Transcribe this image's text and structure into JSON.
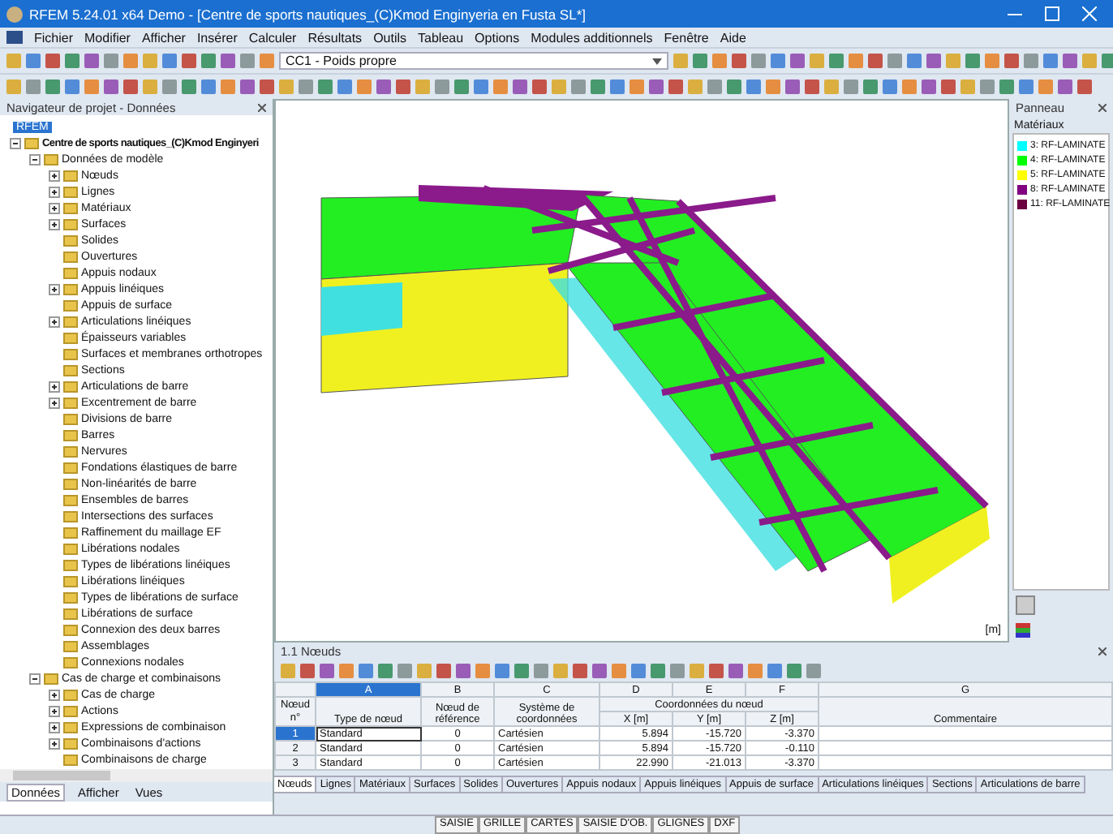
{
  "window": {
    "title": "RFEM 5.24.01 x64 Demo - [Centre de sports nautiques_(C)Kmod Enginyeria en Fusta SL*]"
  },
  "menu": [
    "Fichier",
    "Modifier",
    "Afficher",
    "Insérer",
    "Calculer",
    "Résultats",
    "Outils",
    "Tableau",
    "Options",
    "Modules additionnels",
    "Fenêtre",
    "Aide"
  ],
  "load_case_select": {
    "value": "CC1 - Poids propre"
  },
  "navigator": {
    "title": "Navigateur de projet - Données",
    "root": "RFEM",
    "tree": [
      {
        "label": "Centre de sports nautiques_(C)Kmod Enginyeri",
        "expanded": true,
        "bold": true,
        "children": [
          {
            "label": "Données de modèle",
            "expanded": true,
            "children": [
              {
                "label": "Nœuds",
                "expanded": false
              },
              {
                "label": "Lignes",
                "expanded": false
              },
              {
                "label": "Matériaux",
                "expanded": false
              },
              {
                "label": "Surfaces",
                "expanded": false
              },
              {
                "label": "Solides"
              },
              {
                "label": "Ouvertures"
              },
              {
                "label": "Appuis nodaux"
              },
              {
                "label": "Appuis linéiques",
                "expanded": false
              },
              {
                "label": "Appuis de surface"
              },
              {
                "label": "Articulations linéiques",
                "expanded": false
              },
              {
                "label": "Épaisseurs variables"
              },
              {
                "label": "Surfaces et membranes orthotropes"
              },
              {
                "label": "Sections"
              },
              {
                "label": "Articulations de barre",
                "expanded": false
              },
              {
                "label": "Excentrement de barre",
                "expanded": false
              },
              {
                "label": "Divisions de barre"
              },
              {
                "label": "Barres"
              },
              {
                "label": "Nervures"
              },
              {
                "label": "Fondations élastiques de barre"
              },
              {
                "label": "Non-linéarités de barre"
              },
              {
                "label": "Ensembles de barres"
              },
              {
                "label": "Intersections des surfaces"
              },
              {
                "label": "Raffinement du maillage EF"
              },
              {
                "label": "Libérations nodales"
              },
              {
                "label": "Types de libérations linéiques"
              },
              {
                "label": "Libérations linéiques"
              },
              {
                "label": "Types de libérations de surface"
              },
              {
                "label": "Libérations de surface"
              },
              {
                "label": "Connexion des deux barres"
              },
              {
                "label": "Assemblages"
              },
              {
                "label": "Connexions nodales"
              }
            ]
          },
          {
            "label": "Cas de charge et combinaisons",
            "expanded": true,
            "children": [
              {
                "label": "Cas de charge",
                "expanded": false
              },
              {
                "label": "Actions",
                "expanded": false
              },
              {
                "label": "Expressions de combinaison",
                "expanded": false
              },
              {
                "label": "Combinaisons d'actions",
                "expanded": false
              },
              {
                "label": "Combinaisons de charge"
              }
            ]
          }
        ]
      }
    ],
    "tabs": [
      {
        "label": "Données",
        "selected": true
      },
      {
        "label": "Afficher",
        "selected": false
      },
      {
        "label": "Vues",
        "selected": false
      }
    ]
  },
  "viewport": {
    "unit": "[m]"
  },
  "panel": {
    "title": "Panneau",
    "section": "Matériaux",
    "legend": [
      {
        "label": "3: RF-LAMINATE",
        "color": "#00ffff"
      },
      {
        "label": "4: RF-LAMINATE",
        "color": "#00ff00"
      },
      {
        "label": "5: RF-LAMINATE",
        "color": "#ffff00"
      },
      {
        "label": "8: RF-LAMINATE",
        "color": "#800080"
      },
      {
        "label": "11: RF-LAMINATE",
        "color": "#6a0040"
      }
    ]
  },
  "table": {
    "title": "1.1 Nœuds",
    "row_header": "Nœud n°",
    "group_header": "Coordonnées du nœud",
    "columns": [
      {
        "letter": "A",
        "selected": true,
        "header": "Type de nœud"
      },
      {
        "letter": "B",
        "selected": false,
        "header": "Nœud de référence"
      },
      {
        "letter": "C",
        "selected": false,
        "header": "Système de coordonnées"
      },
      {
        "letter": "D",
        "selected": false,
        "header": "X [m]"
      },
      {
        "letter": "E",
        "selected": false,
        "header": "Y [m]"
      },
      {
        "letter": "F",
        "selected": false,
        "header": "Z [m]"
      },
      {
        "letter": "G",
        "selected": false,
        "header": "Commentaire"
      }
    ],
    "rows": [
      {
        "no": "1",
        "selected": true,
        "cells": [
          "Standard",
          "0",
          "Cartésien",
          "5.894",
          "-15.720",
          "-3.370",
          ""
        ]
      },
      {
        "no": "2",
        "selected": false,
        "cells": [
          "Standard",
          "0",
          "Cartésien",
          "5.894",
          "-15.720",
          "-0.110",
          ""
        ]
      },
      {
        "no": "3",
        "selected": false,
        "cells": [
          "Standard",
          "0",
          "Cartésien",
          "22.990",
          "-21.013",
          "-3.370",
          ""
        ]
      }
    ],
    "tabs": [
      {
        "label": "Nœuds",
        "selected": true
      },
      {
        "label": "Lignes",
        "selected": false
      },
      {
        "label": "Matériaux",
        "selected": false
      },
      {
        "label": "Surfaces",
        "selected": false
      },
      {
        "label": "Solides",
        "selected": false
      },
      {
        "label": "Ouvertures",
        "selected": false
      },
      {
        "label": "Appuis nodaux",
        "selected": false
      },
      {
        "label": "Appuis linéiques",
        "selected": false
      },
      {
        "label": "Appuis de surface",
        "selected": false
      },
      {
        "label": "Articulations linéiques",
        "selected": false
      },
      {
        "label": "Sections",
        "selected": false
      },
      {
        "label": "Articulations de barre",
        "selected": false
      }
    ]
  },
  "status_bar": [
    "SAISIE",
    "GRILLE",
    "CARTES",
    "SAISIE D'OB.",
    "GLIGNES",
    "DXF"
  ]
}
